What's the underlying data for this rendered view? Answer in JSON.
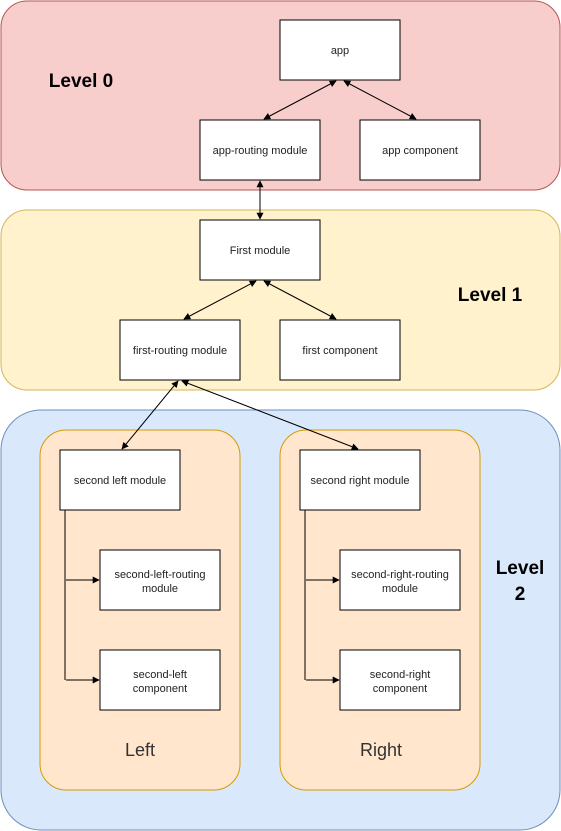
{
  "colors": {
    "level0": "#f8cecc",
    "level0_border": "#b85450",
    "level1": "#fff2cc",
    "level1_border": "#d6b656",
    "level2": "#dae8fc",
    "level2_border": "#6c8ebf",
    "group": "#ffe6cc",
    "group_border": "#d79b00"
  },
  "levels": {
    "l0": "Level 0",
    "l1": "Level 1",
    "l2a": "Level",
    "l2b": "2"
  },
  "groups": {
    "left": "Left",
    "right": "Right"
  },
  "nodes": {
    "app": "app",
    "app_routing": "app-routing module",
    "app_component": "app component",
    "first_module": "First module",
    "first_routing": "first-routing module",
    "first_component": "first component",
    "second_left": "second left module",
    "slr1": "second-left-routing",
    "slr2": "module",
    "slc1": "second-left",
    "slc2": "component",
    "second_right": "second right module",
    "srr1": "second-right-routing",
    "srr2": "module",
    "src1": "second-right",
    "src2": "component"
  }
}
